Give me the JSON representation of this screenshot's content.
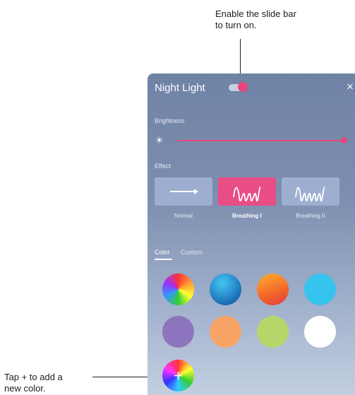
{
  "callouts": {
    "top_line1": "Enable the slide bar",
    "top_line2": "to turn on.",
    "bottom_line1": "Tap + to add a",
    "bottom_line2": "new color."
  },
  "panel": {
    "title": "Night Light",
    "toggle_on": true,
    "close_glyph": "×",
    "brightness_label": "Brightness",
    "brightness_level": 1.0,
    "effect_label": "Effect",
    "effects": [
      {
        "name": "Normal",
        "icon": "arrow-right-icon",
        "selected": false
      },
      {
        "name": "Breathing I",
        "icon": "wave-icon",
        "selected": true
      },
      {
        "name": "Breathing II",
        "icon": "wave-icon",
        "selected": false
      }
    ],
    "tabs": [
      {
        "label": "Color",
        "active": true
      },
      {
        "label": "Custom",
        "active": false
      }
    ],
    "swatches": [
      "rainbow",
      "blue",
      "orange",
      "#36c3ee",
      "#8c74bf",
      "#f7a466",
      "#b7d66a",
      "#ffffff"
    ],
    "add_glyph": "+"
  },
  "colors": {
    "accent": "#e8457d",
    "panel_top": "#6f83a6",
    "panel_bottom": "#c3cfe0"
  }
}
